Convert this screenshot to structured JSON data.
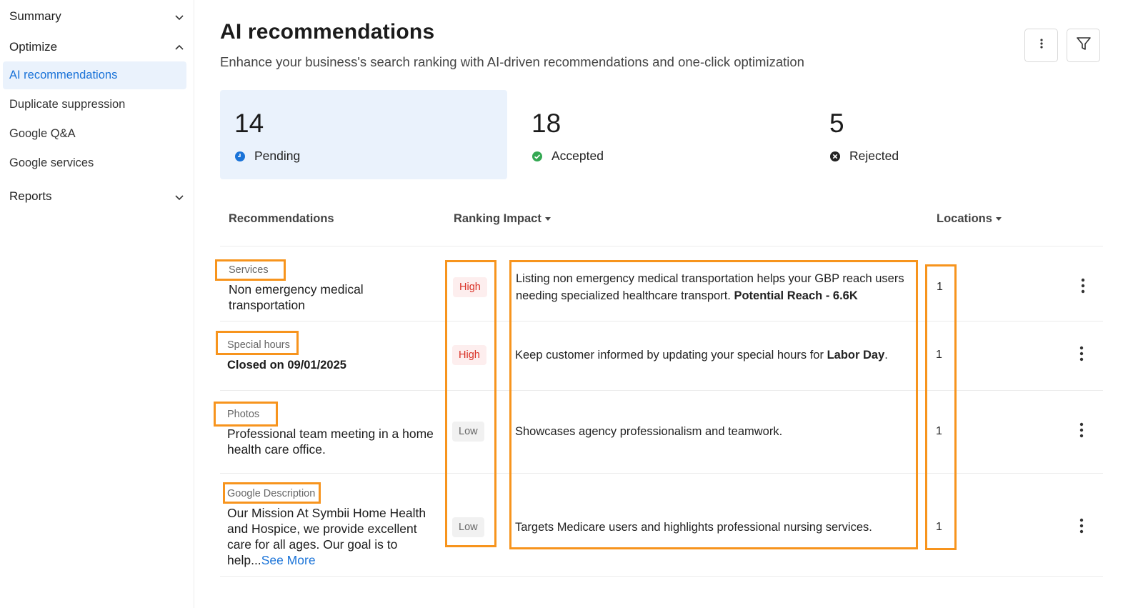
{
  "sidebar": {
    "summary": "Summary",
    "optimize": "Optimize",
    "items": [
      {
        "label": "AI recommendations"
      },
      {
        "label": "Duplicate suppression"
      },
      {
        "label": "Google Q&A"
      },
      {
        "label": "Google services"
      }
    ],
    "reports": "Reports"
  },
  "header": {
    "title": "AI recommendations",
    "subtitle": "Enhance your business's search ranking with AI-driven recommendations and one-click optimization"
  },
  "stats": [
    {
      "count": "14",
      "label": "Pending",
      "icon": "clock-icon",
      "color": "#1a73d8"
    },
    {
      "count": "18",
      "label": "Accepted",
      "icon": "check-circle-icon",
      "color": "#34a853"
    },
    {
      "count": "5",
      "label": "Rejected",
      "icon": "x-circle-icon",
      "color": "#222222"
    }
  ],
  "table": {
    "headers": {
      "recommendations": "Recommendations",
      "ranking_impact": "Ranking Impact",
      "locations": "Locations"
    },
    "rows": [
      {
        "category": "Services",
        "text": "Non emergency medical transportation",
        "impact": "High",
        "desc_pre": "Listing non emergency medical transportation helps your GBP reach users needing specialized healthcare transport. ",
        "desc_bold": "Potential Reach - 6.6K",
        "desc_post": "",
        "locations": "1"
      },
      {
        "category": "Special hours",
        "text": "Closed on 09/01/2025",
        "impact": "High",
        "desc_pre": "Keep customer informed by updating your special hours for ",
        "desc_bold": "Labor Day",
        "desc_post": ".",
        "locations": "1"
      },
      {
        "category": "Photos",
        "text": "Professional team meeting in a home health care office.",
        "impact": "Low",
        "desc_pre": "Showcases agency professionalism and teamwork.",
        "desc_bold": "",
        "desc_post": "",
        "locations": "1"
      },
      {
        "category": "Google Description",
        "text": "Our Mission At Symbii Home Health and Hospice, we provide excellent care for all ages. Our goal is to help...",
        "see_more": "See More",
        "impact": "Low",
        "desc_pre": "Targets Medicare users and highlights professional nursing services.",
        "desc_bold": "",
        "desc_post": "",
        "locations": "1"
      }
    ]
  },
  "colors": {
    "accent": "#1a73d8",
    "highlight": "#f7941d",
    "high": "#d93025"
  }
}
